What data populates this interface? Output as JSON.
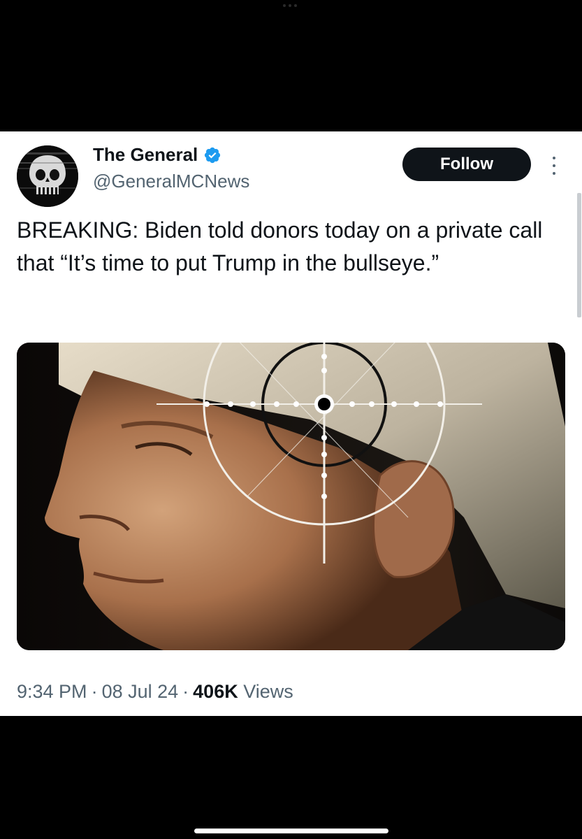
{
  "tweet": {
    "author": {
      "display_name": "The General",
      "handle": "@GeneralMCNews",
      "verified": true,
      "avatar_icon": "skull-avatar-icon"
    },
    "follow_label": "Follow",
    "text": "BREAKING: Biden told donors today on a private call that “It’s time to put Trump in the bullseye.”",
    "media": {
      "kind": "photo"
    },
    "meta": {
      "time": "9:34 PM",
      "date": "08 Jul 24",
      "views_count": "406K",
      "views_label": "Views",
      "separator": "·"
    }
  },
  "colors": {
    "primary_text": "#0f1419",
    "secondary_text": "#536471",
    "verified_blue": "#1d9bf0",
    "follow_bg": "#0f1419",
    "background": "#000000",
    "card": "#ffffff"
  }
}
